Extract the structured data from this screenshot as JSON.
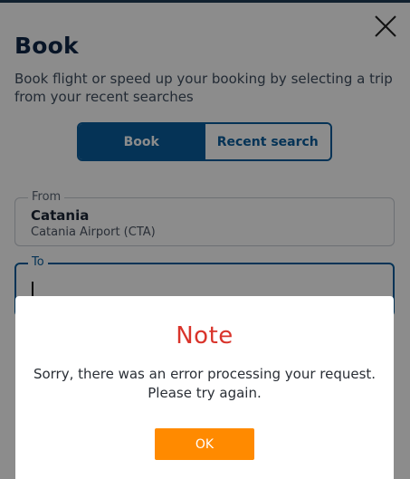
{
  "header": {
    "title": "Book",
    "subtitle": "Book flight or speed up your booking by selecting a trip from your recent searches",
    "close_icon": "close-icon"
  },
  "toggle": {
    "book_label": "Book",
    "recent_label": "Recent search",
    "selected": "Book"
  },
  "form": {
    "from_label": "From",
    "from_city": "Catania",
    "from_airport": "Catania Airport (CTA)",
    "to_label": "To",
    "to_value": ""
  },
  "dialog": {
    "title": "Note",
    "message_line1": "Sorry, there was an error processing your request.",
    "message_line2": "Please try again.",
    "ok_label": "OK"
  },
  "colors": {
    "brand": "#0a5e9d",
    "title": "#0f2747",
    "alert": "#d9342b",
    "ok_button": "#ff8a00"
  }
}
